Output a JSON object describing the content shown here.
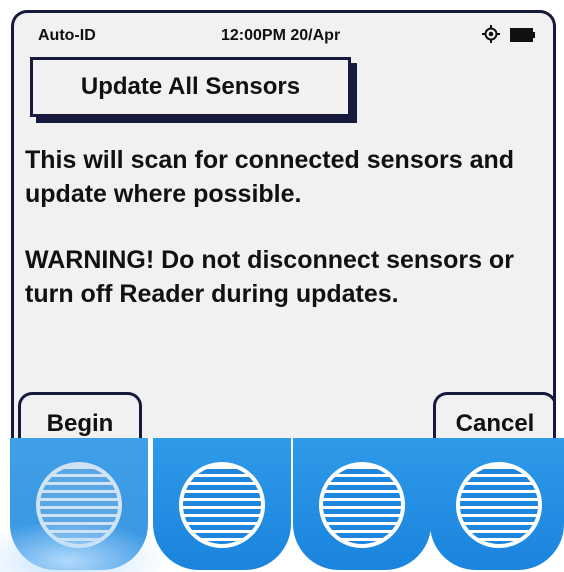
{
  "status_bar": {
    "app_name": "Auto-ID",
    "datetime": "12:00PM 20/Apr",
    "icons": [
      "gps-target-icon",
      "battery-icon"
    ]
  },
  "screen": {
    "title": "Update All Sensors",
    "paragraphs": [
      "This will scan for connected sensors and update where possible.",
      "WARNING! Do not disconnect sensors or turn off Reader during updates."
    ]
  },
  "softkeys": {
    "left": "Begin",
    "right": "Cancel"
  },
  "hardware_keys": {
    "count": 4,
    "color": "#1e86dd"
  },
  "colors": {
    "screen_bg": "#f1f1f1",
    "frame": "#171a3c",
    "key_blue": "#1e86dd"
  }
}
